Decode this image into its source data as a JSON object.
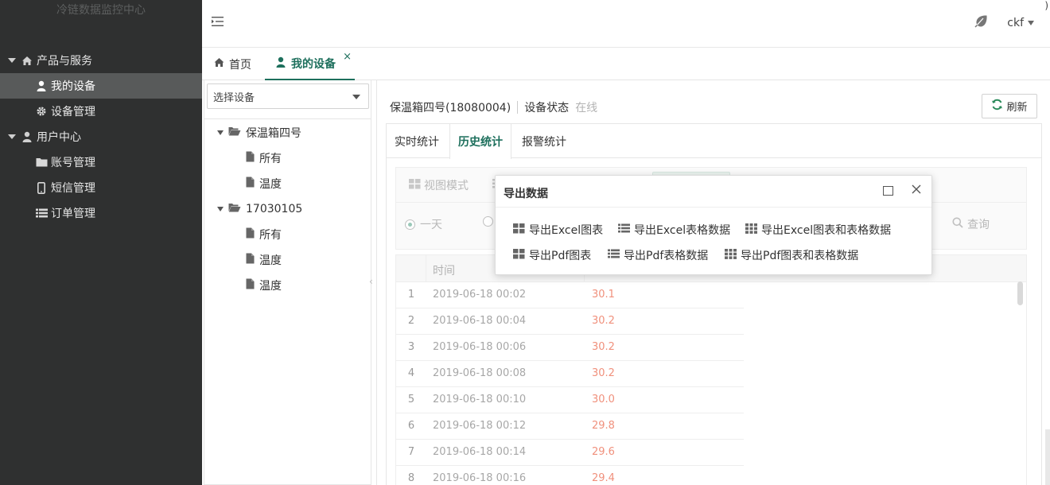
{
  "app": {
    "logo_text": "冷链数据监控中心",
    "user_name": "ckf",
    "corner_char": ")"
  },
  "sidebar": {
    "groups": [
      {
        "label": "产品与服务",
        "items": [
          {
            "label": "我的设备",
            "active": true
          },
          {
            "label": "设备管理"
          }
        ]
      },
      {
        "label": "用户中心",
        "items": [
          {
            "label": "账号管理"
          },
          {
            "label": "短信管理"
          },
          {
            "label": "订单管理"
          }
        ]
      }
    ]
  },
  "tabs": [
    {
      "label": "首页"
    },
    {
      "label": "我的设备",
      "active": true,
      "close": "×"
    }
  ],
  "device_tree": {
    "select_placeholder": "选择设备",
    "nodes": [
      {
        "label": "保温箱四号",
        "children": [
          "所有",
          "温度"
        ]
      },
      {
        "label": "17030105",
        "children": [
          "所有",
          "温度",
          "温度"
        ]
      }
    ],
    "collapse_handle": "‹"
  },
  "device": {
    "name": "保温箱四号(18080004)",
    "status_label": "设备状态",
    "status_value": "在线",
    "refresh_label": "刷新"
  },
  "subtabs": [
    {
      "label": "实时统计"
    },
    {
      "label": "历史统计",
      "active": true
    },
    {
      "label": "报警统计"
    }
  ],
  "filters": {
    "view_mode_label": "视图模式",
    "range_one_day": "一天",
    "query_label": "查询"
  },
  "grid": {
    "header_time": "时间",
    "rows": [
      {
        "idx": "1",
        "time": "2019-06-18 00:02",
        "value": "30.1"
      },
      {
        "idx": "2",
        "time": "2019-06-18 00:04",
        "value": "30.2"
      },
      {
        "idx": "3",
        "time": "2019-06-18 00:06",
        "value": "30.2"
      },
      {
        "idx": "4",
        "time": "2019-06-18 00:08",
        "value": "30.2"
      },
      {
        "idx": "5",
        "time": "2019-06-18 00:10",
        "value": "30.0"
      },
      {
        "idx": "6",
        "time": "2019-06-18 00:12",
        "value": "29.8"
      },
      {
        "idx": "7",
        "time": "2019-06-18 00:14",
        "value": "29.6"
      },
      {
        "idx": "8",
        "time": "2019-06-18 00:16",
        "value": "29.4"
      }
    ]
  },
  "modal": {
    "title": "导出数据",
    "buttons": [
      {
        "label": "导出Excel图表",
        "icon": "grid-2x2-icon"
      },
      {
        "label": "导出Excel表格数据",
        "icon": "list-icon"
      },
      {
        "label": "导出Excel图表和表格数据",
        "icon": "grid-3x3-icon"
      },
      {
        "label": "导出Pdf图表",
        "icon": "grid-2x2-icon"
      },
      {
        "label": "导出Pdf表格数据",
        "icon": "list-icon"
      },
      {
        "label": "导出Pdf图表和表格数据",
        "icon": "grid-3x3-icon"
      }
    ]
  },
  "colors": {
    "sidebar_bg": "#2f3030",
    "accent": "#1d6f5c",
    "value_red": "#f0907c"
  }
}
